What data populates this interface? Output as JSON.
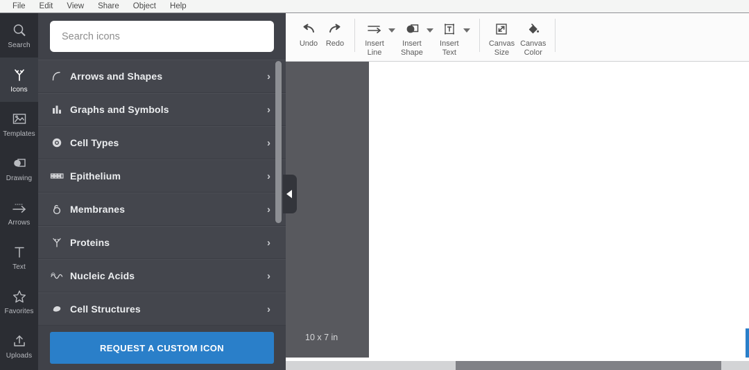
{
  "menubar": {
    "items": [
      {
        "label": "File"
      },
      {
        "label": "Edit"
      },
      {
        "label": "View"
      },
      {
        "label": "Share"
      },
      {
        "label": "Object"
      },
      {
        "label": "Help"
      }
    ]
  },
  "rail": {
    "items": [
      {
        "label": "Search",
        "icon": "magnifier-icon",
        "active": false
      },
      {
        "label": "Icons",
        "icon": "antibody-icon",
        "active": true
      },
      {
        "label": "Templates",
        "icon": "picture-icon",
        "active": false
      },
      {
        "label": "Drawing",
        "icon": "shapes-icon",
        "active": false
      },
      {
        "label": "Arrows",
        "icon": "arrow-right-icon",
        "active": false
      },
      {
        "label": "Text",
        "icon": "text-t-icon",
        "active": false
      },
      {
        "label": "Favorites",
        "icon": "star-icon",
        "active": false
      },
      {
        "label": "Uploads",
        "icon": "upload-icon",
        "active": false
      }
    ]
  },
  "panel": {
    "search": {
      "placeholder": "Search icons",
      "value": ""
    },
    "categories": [
      {
        "label": "Arrows and Shapes",
        "icon": "curved-arrow-icon",
        "chevron": "›"
      },
      {
        "label": "Graphs and Symbols",
        "icon": "bar-chart-icon",
        "chevron": "›"
      },
      {
        "label": "Cell Types",
        "icon": "cell-circle-icon",
        "chevron": "›"
      },
      {
        "label": "Epithelium",
        "icon": "epithelium-icon",
        "chevron": "›"
      },
      {
        "label": "Membranes",
        "icon": "membrane-icon",
        "chevron": "›"
      },
      {
        "label": "Proteins",
        "icon": "protein-icon",
        "chevron": "›"
      },
      {
        "label": "Nucleic Acids",
        "icon": "dna-wave-icon",
        "chevron": "›"
      },
      {
        "label": "Cell Structures",
        "icon": "organelle-icon",
        "chevron": "›"
      }
    ],
    "cta_label": "REQUEST A CUSTOM ICON",
    "cta_color": "#2a7fc9"
  },
  "collapse_handle": {
    "name": "collapse-panel-handle",
    "direction": "left"
  },
  "toolbar": {
    "undo_label": "Undo",
    "redo_label": "Redo",
    "insert_line_label": "Insert\nLine",
    "insert_shape_label": "Insert\nShape",
    "insert_text_label": "Insert\nText",
    "canvas_size_label": "Canvas\nSize",
    "canvas_color_label": "Canvas\nColor"
  },
  "workspace": {
    "canvas_size_text": "10 x 7 in",
    "canvas_background": "#ffffff",
    "workspace_background": "#58595e"
  }
}
